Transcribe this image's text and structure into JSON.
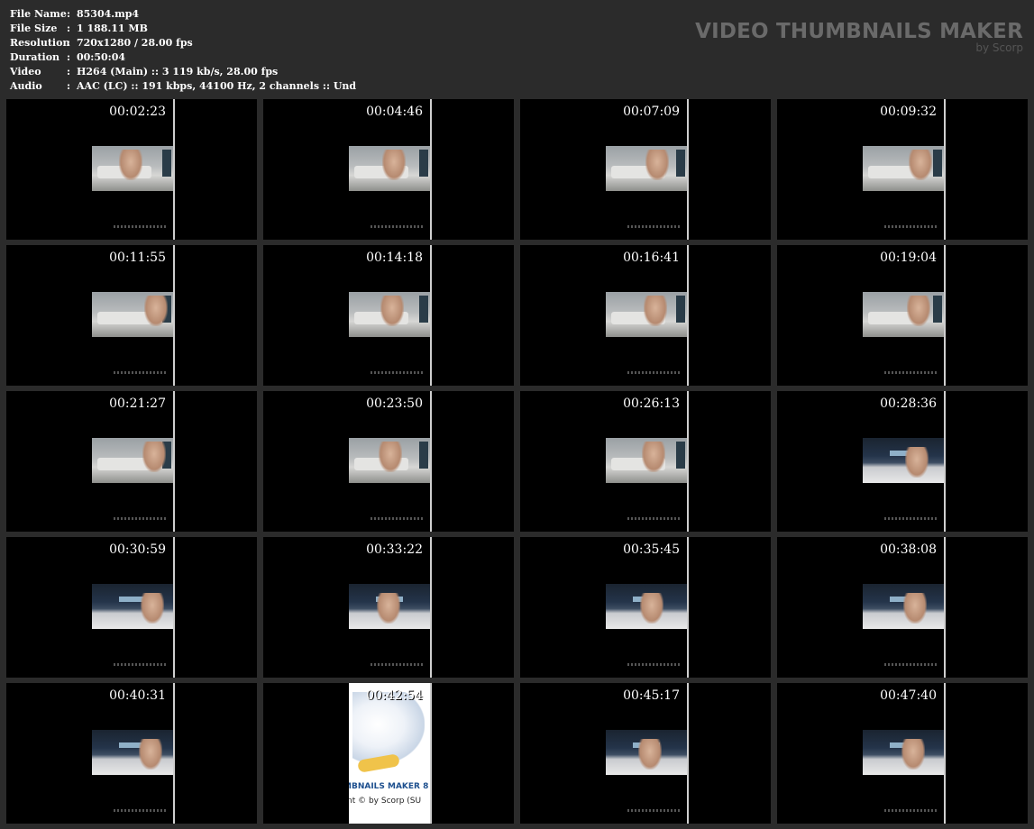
{
  "info": [
    {
      "key": "File Name",
      "value": "85304.mp4"
    },
    {
      "key": "File Size",
      "value": "1 188.11 MB"
    },
    {
      "key": "Resolution",
      "value": "720x1280 / 28.00 fps"
    },
    {
      "key": "Duration",
      "value": "00:50:04"
    },
    {
      "key": "Video",
      "value": "H264 (Main) :: 3 119 kb/s, 28.00 fps"
    },
    {
      "key": "Audio",
      "value": "AAC (LC) :: 191 kbps, 44100 Hz, 2 channels :: Und"
    }
  ],
  "separator": ":",
  "brand": {
    "title": "VIDEO THUMBNAILS MAKER",
    "subtitle": "by Scorp"
  },
  "thumbnails": [
    {
      "time": "00:02:23",
      "scene": "room"
    },
    {
      "time": "00:04:46",
      "scene": "room"
    },
    {
      "time": "00:07:09",
      "scene": "room"
    },
    {
      "time": "00:09:32",
      "scene": "room"
    },
    {
      "time": "00:11:55",
      "scene": "room"
    },
    {
      "time": "00:14:18",
      "scene": "room"
    },
    {
      "time": "00:16:41",
      "scene": "room"
    },
    {
      "time": "00:19:04",
      "scene": "room"
    },
    {
      "time": "00:21:27",
      "scene": "room"
    },
    {
      "time": "00:23:50",
      "scene": "room"
    },
    {
      "time": "00:26:13",
      "scene": "room"
    },
    {
      "time": "00:28:36",
      "scene": "bed"
    },
    {
      "time": "00:30:59",
      "scene": "bed"
    },
    {
      "time": "00:33:22",
      "scene": "bed"
    },
    {
      "time": "00:35:45",
      "scene": "bed"
    },
    {
      "time": "00:38:08",
      "scene": "bed"
    },
    {
      "time": "00:40:31",
      "scene": "bed"
    },
    {
      "time": "00:42:54",
      "scene": "ad"
    },
    {
      "time": "00:45:17",
      "scene": "bed"
    },
    {
      "time": "00:47:40",
      "scene": "bed"
    }
  ],
  "ad_text": {
    "line1": "MBNAILS MAKER 8",
    "line2": "nt © by Scorp (SU"
  }
}
